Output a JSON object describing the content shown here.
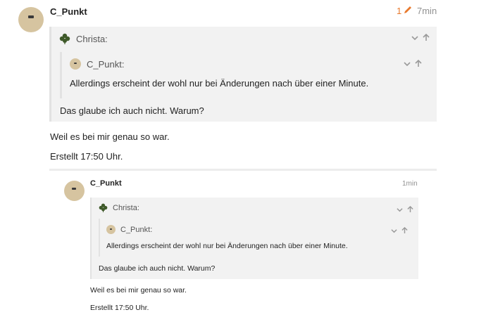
{
  "post": {
    "username": "C_Punkt",
    "edit_count": "1",
    "time": "7min",
    "quote": {
      "author": "Christa:",
      "nested": {
        "author": "C_Punkt:",
        "text": "Allerdings erscheint der wohl nur bei Änderungen nach über einer Minute."
      },
      "text": "Das glaube ich auch nicht. Warum?"
    },
    "body_line1": "Weil es bei mir genau so war.",
    "body_line2": "Erstellt 17:50 Uhr."
  },
  "embedded": {
    "username": "C_Punkt",
    "time": "1min",
    "quote": {
      "author": "Christa:",
      "nested": {
        "author": "C_Punkt:",
        "text": "Allerdings erscheint der wohl nur bei Änderungen nach über einer Minute."
      },
      "text": "Das glaube ich auch nicht. Warum?"
    },
    "body_line1": "Weil es bei mir genau so war.",
    "body_line2": "Erstellt 17:50 Uhr."
  },
  "icons": {
    "expand": "chevron-down-icon",
    "jump": "arrow-up-icon",
    "edit": "pencil-icon",
    "clover": "clover-icon"
  },
  "colors": {
    "accent": "#e8792d",
    "quote_bg": "#f2f2f2",
    "meta": "#919191"
  }
}
